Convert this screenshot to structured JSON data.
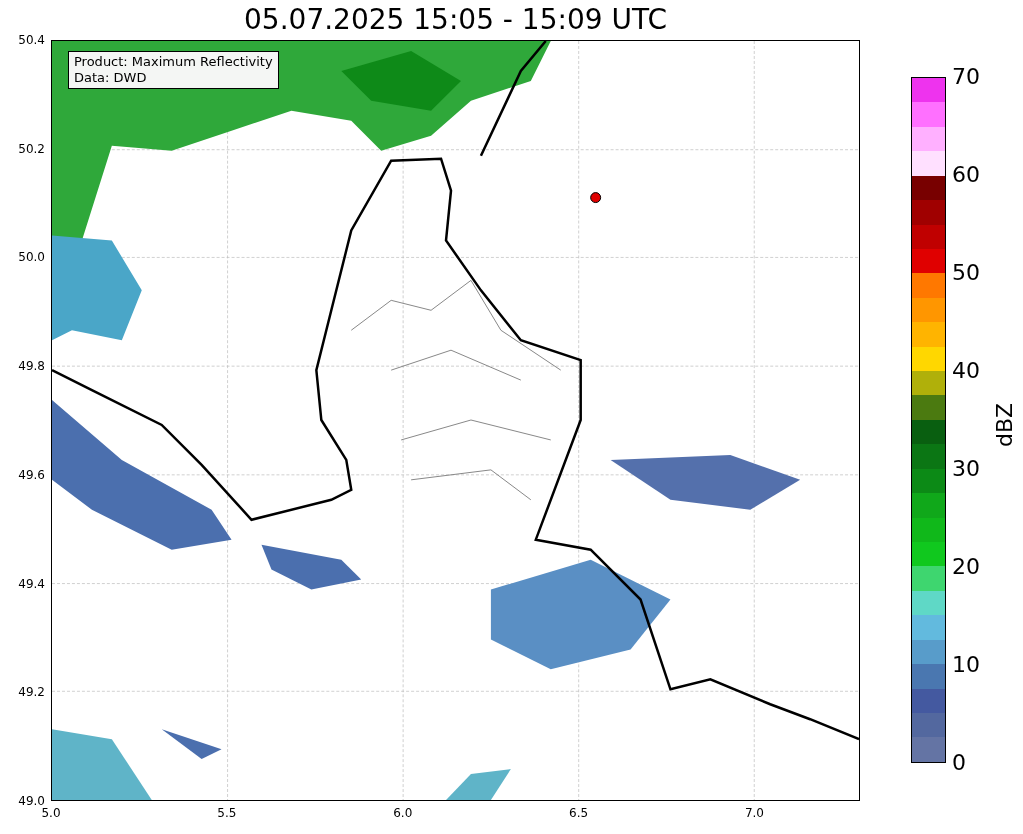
{
  "title": "05.07.2025 15:05 - 15:09 UTC",
  "info_box": [
    "Product: Maximum Reflectivity",
    "Data: DWD"
  ],
  "x_ticks": [
    "5.0",
    "5.5",
    "6.0",
    "6.5",
    "7.0"
  ],
  "y_ticks": [
    "50.4",
    "50.2",
    "50.0",
    "49.8",
    "49.6",
    "49.4",
    "49.2",
    "49.0"
  ],
  "colorbar": {
    "label": "dBZ",
    "ticks": [
      "70",
      "60",
      "50",
      "40",
      "30",
      "20",
      "10",
      "0"
    ],
    "bands": [
      {
        "color": "#ee33ee"
      },
      {
        "color": "#ff70ff"
      },
      {
        "color": "#ffb0ff"
      },
      {
        "color": "#ffe0ff"
      },
      {
        "color": "#780000"
      },
      {
        "color": "#a00000"
      },
      {
        "color": "#c00000"
      },
      {
        "color": "#e00000"
      },
      {
        "color": "#ff7800"
      },
      {
        "color": "#ff9600"
      },
      {
        "color": "#ffb400"
      },
      {
        "color": "#ffd700"
      },
      {
        "color": "#b0b00a"
      },
      {
        "color": "#4b7a10"
      },
      {
        "color": "#095f10"
      },
      {
        "color": "#0b7614"
      },
      {
        "color": "#0c8a16"
      },
      {
        "color": "#10a81a"
      },
      {
        "color": "#10b81a"
      },
      {
        "color": "#10c81e"
      },
      {
        "color": "#3ed66f"
      },
      {
        "color": "#5fd8c6"
      },
      {
        "color": "#62bade"
      },
      {
        "color": "#589cca"
      },
      {
        "color": "#4a77b0"
      },
      {
        "color": "#4459a0"
      },
      {
        "color": "#53689f"
      },
      {
        "color": "#6474a4"
      }
    ]
  }
}
